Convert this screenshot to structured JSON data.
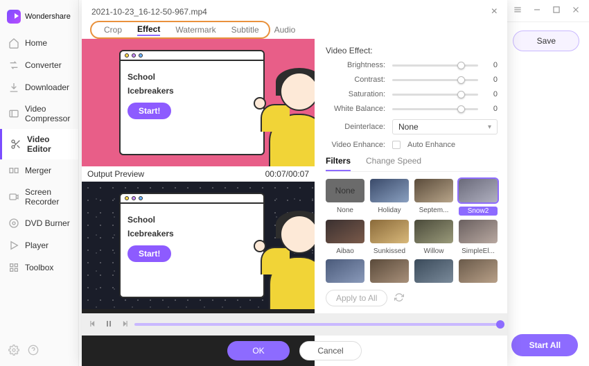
{
  "brand": "Wondershare",
  "sidebar": {
    "items": [
      {
        "label": "Home"
      },
      {
        "label": "Converter"
      },
      {
        "label": "Downloader"
      },
      {
        "label": "Video Compressor"
      },
      {
        "label": "Video Editor"
      },
      {
        "label": "Merger"
      },
      {
        "label": "Screen Recorder"
      },
      {
        "label": "DVD Burner"
      },
      {
        "label": "Player"
      },
      {
        "label": "Toolbox"
      }
    ]
  },
  "buttons": {
    "save": "Save",
    "start_all": "Start All",
    "ok": "OK",
    "cancel": "Cancel",
    "apply_all": "Apply to All"
  },
  "modal": {
    "filename": "2021-10-23_16-12-50-967.mp4",
    "tabs": [
      "Crop",
      "Effect",
      "Watermark",
      "Subtitle",
      "Audio"
    ],
    "active_tab": "Effect",
    "output_label": "Output Preview",
    "timestamp": "00:07/00:07",
    "preview": {
      "headline1": "School",
      "headline2": "Icebreakers",
      "start": "Start!"
    }
  },
  "effect": {
    "section": "Video Effect:",
    "rows": [
      {
        "label": "Brightness:",
        "value": "0",
        "pos": 76
      },
      {
        "label": "Contrast:",
        "value": "0",
        "pos": 76
      },
      {
        "label": "Saturation:",
        "value": "0",
        "pos": 76
      },
      {
        "label": "White Balance:",
        "value": "0",
        "pos": 76
      }
    ],
    "deinterlace_label": "Deinterlace:",
    "deinterlace_value": "None",
    "enhance_label": "Video Enhance:",
    "auto_enhance": "Auto Enhance",
    "subtabs": [
      "Filters",
      "Change Speed"
    ],
    "active_subtab": "Filters",
    "filters_row1": [
      {
        "label": "None",
        "none": true
      },
      {
        "label": "Holiday"
      },
      {
        "label": "Septem..."
      },
      {
        "label": "Snow2",
        "selected": true
      }
    ],
    "filters_row2": [
      {
        "label": "Aibao"
      },
      {
        "label": "Sunkissed"
      },
      {
        "label": "Willow"
      },
      {
        "label": "SimpleEl..."
      }
    ]
  }
}
